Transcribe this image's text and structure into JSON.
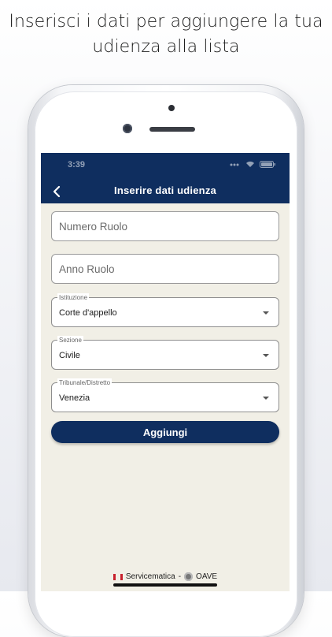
{
  "headline": {
    "line1": "Inserisci i dati per aggiungere la tua",
    "line2": "udienza alla lista"
  },
  "status_bar": {
    "time": "3:39"
  },
  "app_bar": {
    "title": "Inserire dati udienza",
    "back_icon": "chevron-left-icon"
  },
  "form": {
    "numero_ruolo": {
      "placeholder": "Numero Ruolo",
      "value": ""
    },
    "anno_ruolo": {
      "placeholder": "Anno Ruolo",
      "value": ""
    },
    "istituzione": {
      "label": "Istituzione",
      "value": "Corte d'appello"
    },
    "sezione": {
      "label": "Sezione",
      "value": "Civile"
    },
    "tribunale": {
      "label": "Tribunale/Distretto",
      "value": "Venezia"
    },
    "submit_label": "Aggiungi"
  },
  "footer": {
    "left_text": "Servicematica",
    "separator": "-",
    "right_text": "OAVE"
  },
  "colors": {
    "primary": "#0f2e5f",
    "background": "#f1efe6",
    "brand_red": "#c8202c"
  }
}
